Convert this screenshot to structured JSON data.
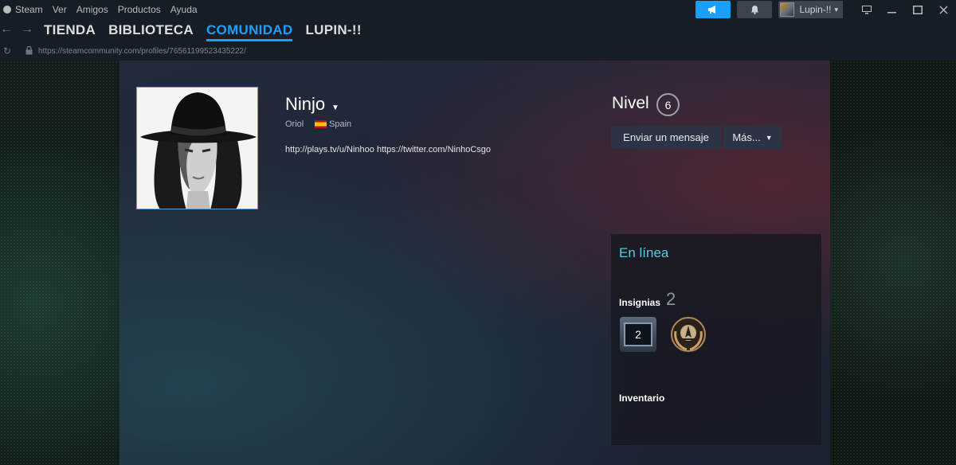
{
  "menu": {
    "items": [
      "Steam",
      "Ver",
      "Amigos",
      "Productos",
      "Ayuda"
    ]
  },
  "account": {
    "name": "Lupin-!!"
  },
  "nav": {
    "tabs": [
      "TIENDA",
      "BIBLIOTECA",
      "COMUNIDAD",
      "LUPIN-!!"
    ],
    "active": "COMUNIDAD"
  },
  "url": "https://steamcommunity.com/profiles/76561199523435222/",
  "profile": {
    "persona_name": "Ninjo",
    "real_name": "Oriol",
    "country": "Spain",
    "summary": "http://plays.tv/u/Ninhoo https://twitter.com/NinhoCsgo",
    "level_label": "Nivel",
    "level": "6",
    "message_button": "Enviar un mensaje",
    "more_button": "Más...",
    "status": "En línea",
    "badges_label": "Insignias",
    "badges_count": "2",
    "badge_years": "2",
    "inventory_label": "Inventario"
  },
  "colors": {
    "accent": "#1a9fff",
    "online": "#57cbde",
    "background": "#1b2838"
  },
  "icons": [
    "steam-icon",
    "megaphone-icon",
    "bell-icon",
    "monitor-icon",
    "minimize-icon",
    "maximize-icon",
    "close-icon",
    "back-arrow-icon",
    "forward-arrow-icon",
    "reload-icon",
    "lock-icon",
    "chevron-down-icon",
    "spain-flag-icon"
  ]
}
